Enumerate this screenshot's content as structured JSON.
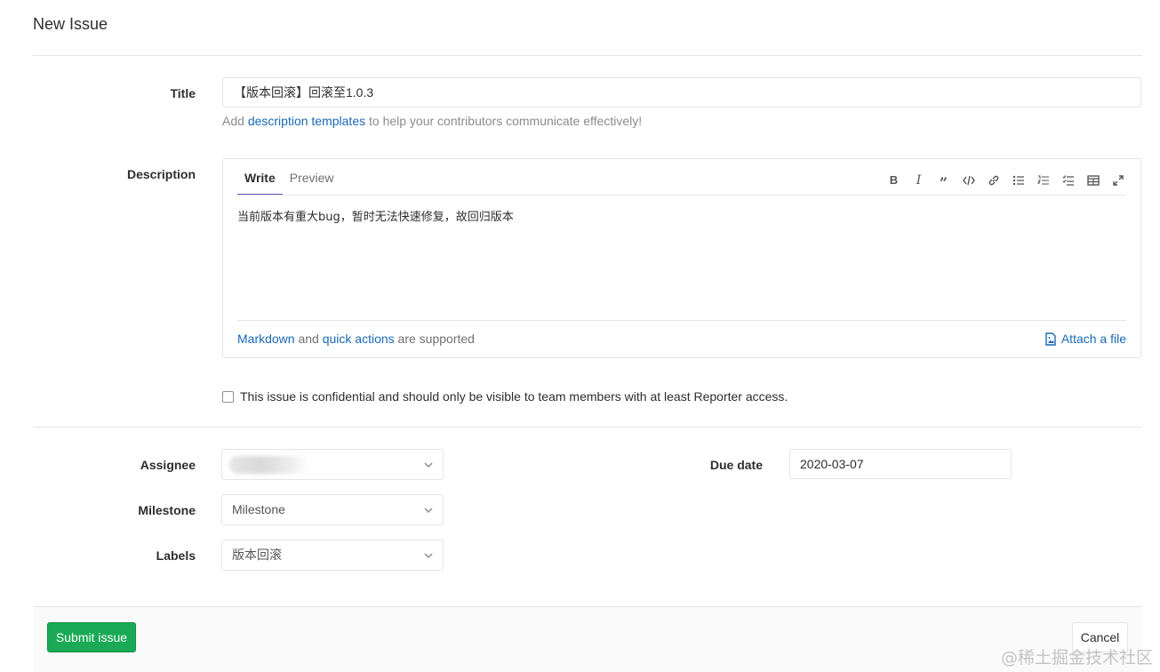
{
  "page": {
    "title": "New Issue"
  },
  "title_field": {
    "label": "Title",
    "value": "【版本回滚】回滚至1.0.3"
  },
  "hint": {
    "prefix": "Add ",
    "link": "description templates",
    "suffix": " to help your contributors communicate effectively!"
  },
  "description": {
    "label": "Description",
    "tabs": [
      {
        "label": "Write",
        "active": true
      },
      {
        "label": "Preview",
        "active": false
      }
    ],
    "toolbar": [
      "bold-icon",
      "italic-icon",
      "quote-icon",
      "code-icon",
      "link-icon",
      "bullet-list-icon",
      "numbered-list-icon",
      "task-list-icon",
      "table-icon",
      "fullscreen-icon"
    ],
    "text": "当前版本有重大bug，暂时无法快速修复，故回归版本",
    "footer": {
      "markdown_link": "Markdown",
      "and": " and ",
      "quick_actions_link": "quick actions",
      "supported": " are supported",
      "attach_label": "Attach a file"
    }
  },
  "confidential": {
    "label": "This issue is confidential and should only be visible to team members with at least Reporter access."
  },
  "assignee": {
    "label": "Assignee",
    "value": ""
  },
  "milestone": {
    "label": "Milestone",
    "value": "Milestone"
  },
  "labels": {
    "label": "Labels",
    "value": "版本回滚"
  },
  "due_date": {
    "label": "Due date",
    "value": "2020-03-07"
  },
  "actions": {
    "submit_label": "Submit issue",
    "cancel_label": "Cancel"
  },
  "watermark": "@稀土掘金技术社区",
  "colors": {
    "submit_green": "#1aaa55",
    "link_blue": "#1b69b6",
    "tab_underline": "#6b4fbb"
  }
}
